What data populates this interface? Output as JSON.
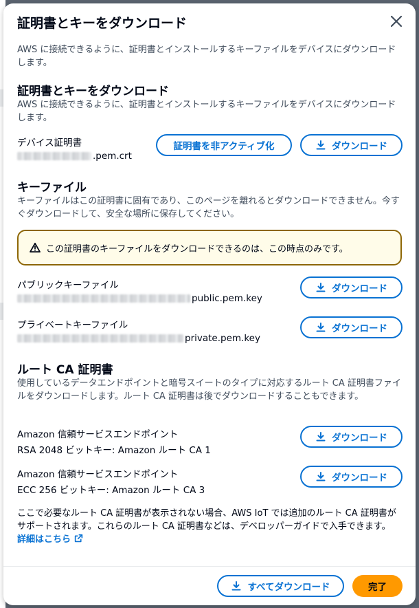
{
  "modal": {
    "title": "証明書とキーをダウンロード",
    "intro": "AWS に接続できるように、証明書とインストールするキーファイルをデバイスにダウンロードします。"
  },
  "certificate_section": {
    "title": "証明書とキーをダウンロード",
    "description": "AWS に接続できるように、証明書とインストールするキーファイルをデバイスにダウンロードします。",
    "device_cert_label": "デバイス証明書",
    "device_cert_file_suffix": ".pem.crt",
    "deactivate_button": "証明書を非アクティブ化",
    "download_button": "ダウンロード"
  },
  "key_section": {
    "title": "キーファイル",
    "description": "キーファイルはこの証明書に固有であり、このページを離れるとダウンロードできません。今すぐダウンロードして、安全な場所に保存してください。",
    "alert_text": "この証明書のキーファイルをダウンロードできるのは、この時点のみです。",
    "public_key_label": "パブリックキーファイル",
    "public_key_file_suffix": "public.pem.key",
    "private_key_label": "プライベートキーファイル",
    "private_key_file_suffix": "private.pem.key",
    "download_button": "ダウンロード"
  },
  "root_ca_section": {
    "title": "ルート CA 証明書",
    "description": "使用しているデータエンドポイントと暗号スイートのタイプに対応するルート CA 証明書ファイルをダウンロードします。ルート CA 証明書は後でダウンロードすることもできます。",
    "ca1_label": "Amazon 信頼サービスエンドポイント",
    "ca1_value": "RSA 2048 ビットキー: Amazon ルート CA 1",
    "ca3_label": "Amazon 信頼サービスエンドポイント",
    "ca3_value": "ECC 256 ビットキー: Amazon ルート CA 3",
    "download_button": "ダウンロード",
    "note": "ここで必要なルート CA 証明書が表示されない場合、AWS IoT では追加のルート CA 証明書がサポートされます。これらのルート CA 証明書などは、デベロッパーガイドで入手できます。",
    "link_text": "詳細はこちら"
  },
  "footer": {
    "download_all_button": "すべてダウンロード",
    "done_button": "完了"
  },
  "colors": {
    "accent": "#0972d3",
    "primary_button": "#ff9900",
    "warning_border": "#8d6605",
    "warning_bg": "#fffce9"
  }
}
